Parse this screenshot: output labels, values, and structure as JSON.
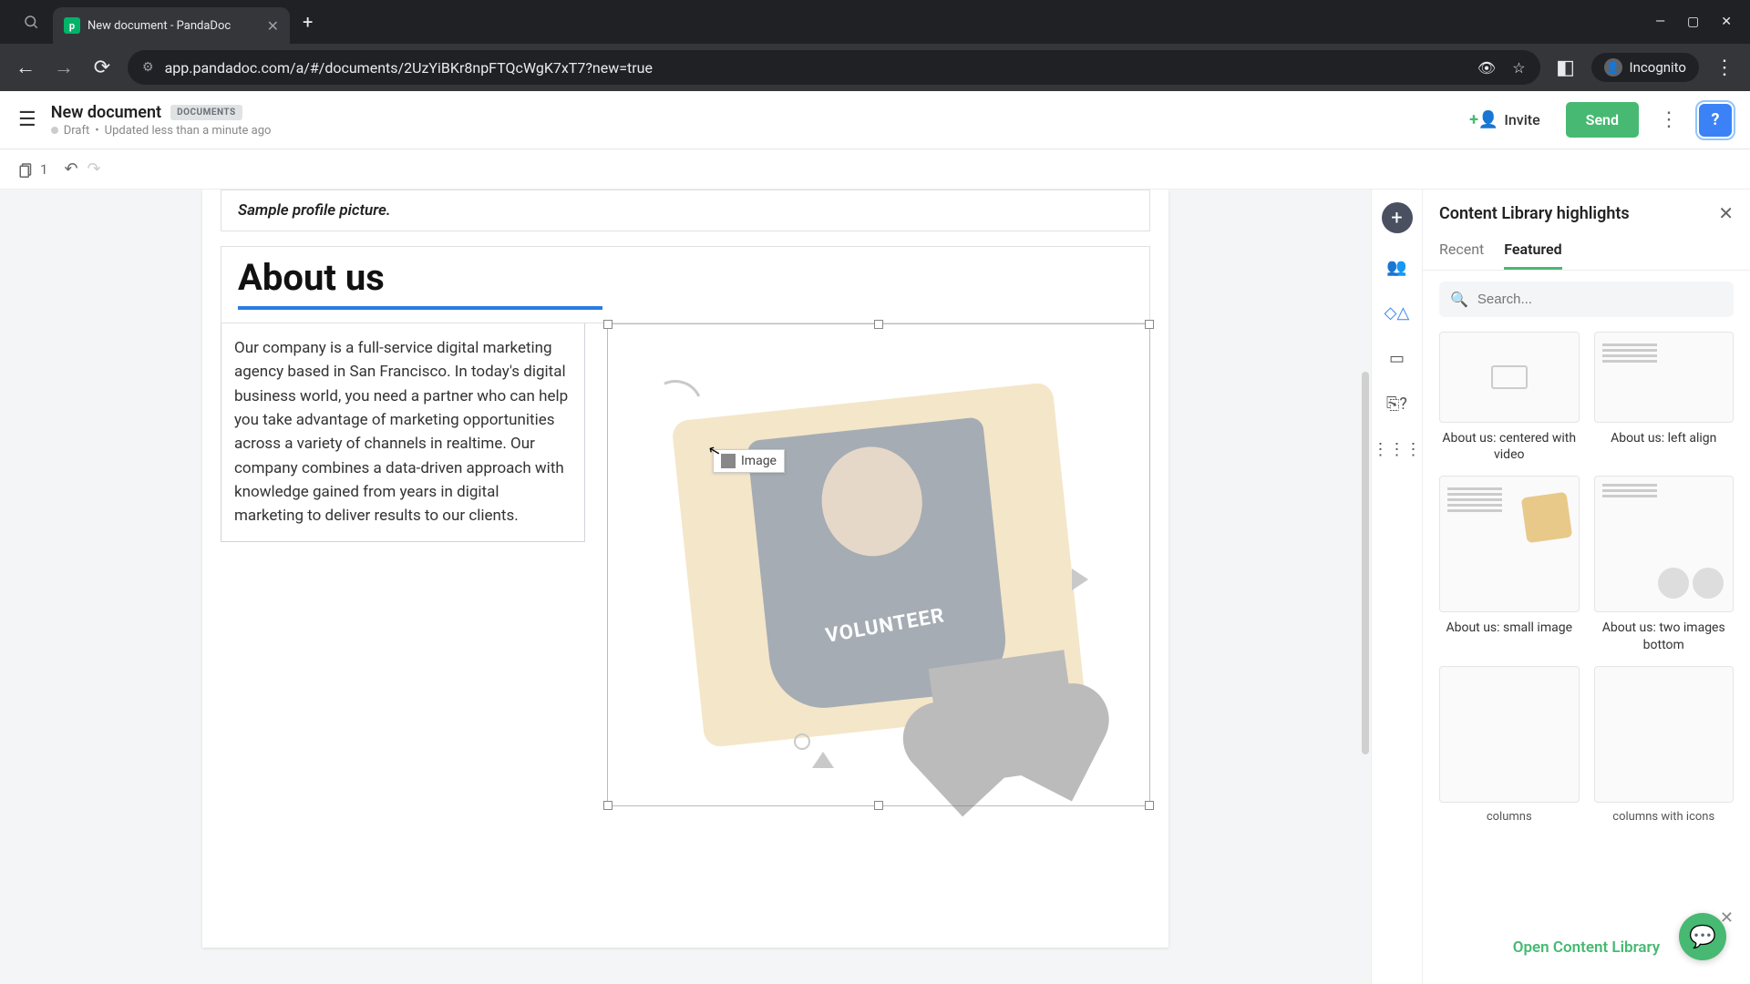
{
  "browser": {
    "tab_title": "New document - PandaDoc",
    "url": "app.pandadoc.com/a/#/documents/2UzYiBKr8npFTQcWgK7xT7?new=true",
    "incognito_label": "Incognito"
  },
  "header": {
    "doc_title": "New document",
    "doc_badge": "DOCUMENTS",
    "status": "Draft",
    "updated": "Updated less than a minute ago",
    "invite": "Invite",
    "send": "Send"
  },
  "toolbar": {
    "page_count": "1"
  },
  "document": {
    "caption": "Sample profile picture.",
    "heading": "About us",
    "body": "Our company is a full-service digital marketing agency based in San Francisco. In today's digital business world, you need a partner who can help you take advantage of marketing opportunities across a variety of channels in realtime. Our company combines a data-driven approach with knowledge gained from years in digital marketing to deliver results to our clients.",
    "drag_label": "Image",
    "shirt_text": "VOLUNTEER"
  },
  "panel": {
    "title": "Content Library highlights",
    "tabs": {
      "recent": "Recent",
      "featured": "Featured"
    },
    "search_placeholder": "Search...",
    "cards": [
      "About us: centered with video",
      "About us: left align",
      "About us: small image",
      "About us: two images bottom"
    ],
    "bottom_labels": [
      "columns",
      "columns with icons"
    ],
    "open_link": "Open Content Library"
  }
}
